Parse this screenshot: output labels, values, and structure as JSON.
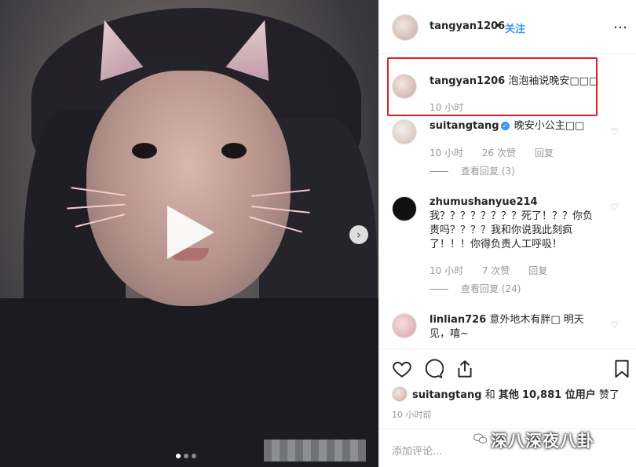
{
  "header": {
    "username": "tangyan1206",
    "separator": "•",
    "follow_label": "关注",
    "more_label": "…"
  },
  "caption": {
    "username": "tangyan1206",
    "text": "泡泡袖说晚安□□□",
    "time": "10 小时"
  },
  "comments": [
    {
      "username": "suitangtang",
      "verified": true,
      "text": "晚安小公主□□",
      "time": "10 小时",
      "likes": "26 次赞",
      "reply_label": "回复",
      "view_replies": "查看回复 (3)"
    },
    {
      "username": "zhumushanyue214",
      "text": "我？？？？？？？？死了！？？你负责吗？？？？我和你说我此刻疯了！！！你得负责人工呼吸！",
      "time": "10 小时",
      "likes": "7 次赞",
      "reply_label": "回复",
      "view_replies": "查看回复 (24)"
    },
    {
      "username": "linlian726",
      "text": "意外地木有胖□ 明天见，嘻~"
    }
  ],
  "likes": {
    "user": "suitangtang",
    "and": "和",
    "others_prefix": "其他",
    "count": "10,881 位用户",
    "suffix": "赞了"
  },
  "time_ago": "10 小时前",
  "comment_placeholder": "添加评论...",
  "watermark": "深八深夜八卦",
  "colors": {
    "accent": "#3897f0",
    "highlight_box": "#e02020"
  }
}
